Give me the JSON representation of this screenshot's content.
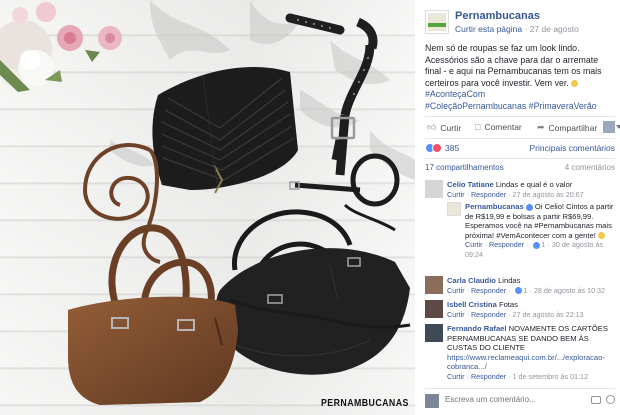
{
  "photo": {
    "brand_wordmark": "PERNAMBUCANAS"
  },
  "post": {
    "page_name": "Pernambucanas",
    "like_page": "Curtir esta página",
    "separator": "·",
    "date": "27 de agosto",
    "text_main": "Nem só de roupas se faz um look lindo. Acessórios são a chave para dar o arremate final - e aqui na Pernambucanas tem os mais certeiros para você investir. Vem ver.",
    "hashtag_acontece": "#AconteçaCom",
    "hashtags_line": "#ColeçãoPernambucanas #PrimaveraVerão"
  },
  "actions": {
    "like": "Curtir",
    "comment": "Comentar",
    "share": "Compartilhar"
  },
  "reactions": {
    "count": "385",
    "relevant": "Principais comentários"
  },
  "shares": {
    "shares_label": "17 compartilhamentos",
    "comments_count": "4 comentários"
  },
  "comments": [
    {
      "name": "Celio Tatiane",
      "text": "Lindas e qual é o valor",
      "like": "Curtir",
      "reply": "Responder",
      "time": "27 de agosto às 20:67"
    },
    {
      "name": "Pernambucanas",
      "text": "Oi Celio! Cintos a partir de R$19,99 e bolsas a partir R$69,99. Esperamos você na #Pernambucanas mais próxima! #VemAcontecer com a gente!",
      "like": "Curtir",
      "reply": "Responder",
      "likes": "1",
      "time": "30 de agosto às 09:24"
    },
    {
      "name": "Carla Claudio",
      "text": "Lindas",
      "like": "Curtir",
      "reply": "Responder",
      "likes": "1",
      "time": "28 de agosto às 10:32"
    },
    {
      "name": "Isbell Cristina",
      "text": "Fotas",
      "like": "Curtir",
      "reply": "Responder",
      "time": "27 de agosto às 22:13"
    },
    {
      "name": "Fernando Rafael",
      "text": "NOVAMENTE OS CARTÕES PERNAMBUCANAS SE DANDO BEM ÀS CUSTAS DO CLIENTE",
      "link": "https://www.reclameaqui.com.br/.../exploracao-cobranca.../",
      "like": "Curtir",
      "reply": "Responder",
      "time": "1 de setembro às 01:12"
    }
  ],
  "write": {
    "placeholder": "Escreva um comentário..."
  },
  "colors": {
    "link": "#365899",
    "meta": "#90949c",
    "like_blue": "#5890ff",
    "love_red": "#f25268",
    "bag_brown": "#7a4a2c",
    "bag_black": "#1f1f1f"
  }
}
